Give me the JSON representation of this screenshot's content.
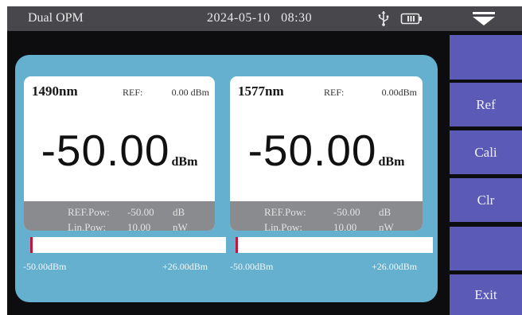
{
  "status_bar": {
    "title": "Dual OPM",
    "datetime": "2024-05-10   08:30",
    "icons": [
      "usb-icon",
      "battery-icon",
      "menu-dropdown-icon"
    ]
  },
  "channels": [
    {
      "wavelength": "1490nm",
      "ref_label": "REF:",
      "ref_value": "0.00 dBm",
      "reading": "-50.00",
      "reading_unit": "dBm",
      "ref_pow_label": "REF.Pow:",
      "ref_pow_value": "-50.00",
      "ref_pow_unit": "dB",
      "lin_pow_label": "Lin.Pow:",
      "lin_pow_value": "10.00",
      "lin_pow_unit": "nW",
      "range_min": "-50.00dBm",
      "range_max": "+26.00dBm",
      "level_fraction": 0.0
    },
    {
      "wavelength": "1577nm",
      "ref_label": "REF:",
      "ref_value": "0.00dBm",
      "reading": "-50.00",
      "reading_unit": "dBm",
      "ref_pow_label": "REF.Pow:",
      "ref_pow_value": "-50.00",
      "ref_pow_unit": "dB",
      "lin_pow_label": "Lin.Pow:",
      "lin_pow_value": "10.00",
      "lin_pow_unit": "nW",
      "range_min": "-50.00dBm",
      "range_max": "+26.00dBm",
      "level_fraction": 0.0
    }
  ],
  "side_buttons": [
    "",
    "Ref",
    "Cali",
    "Clr",
    "",
    "Exit"
  ],
  "colors": {
    "panel": "#66b0cf",
    "button": "#5b5bb7",
    "status_bar": "#48484c",
    "marker": "#c2163a"
  }
}
